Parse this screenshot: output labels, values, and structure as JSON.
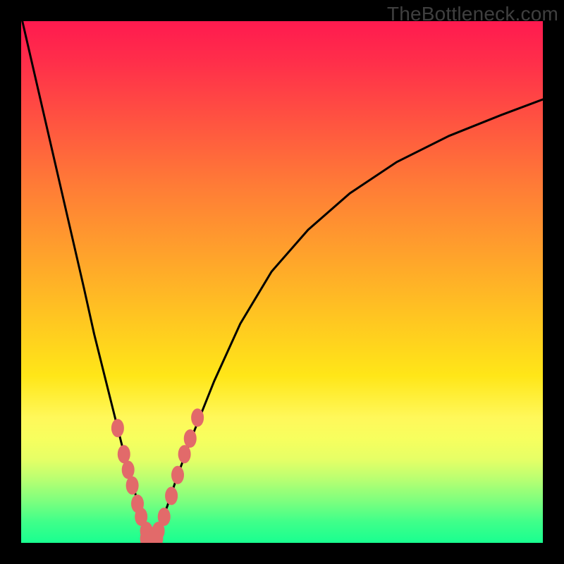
{
  "watermark": "TheBottleneck.com",
  "gradient": {
    "top": "#ff1a4f",
    "mid": "#ffe618",
    "bottom": "#19ff90"
  },
  "chart_data": {
    "type": "line",
    "title": "",
    "xlabel": "",
    "ylabel": "",
    "xlim": [
      0,
      100
    ],
    "ylim": [
      0,
      100
    ],
    "grid": false,
    "legend": false,
    "series": [
      {
        "name": "curve-left",
        "x": [
          0,
          3,
          6,
          9,
          12,
          14,
          16,
          18,
          20,
          22,
          23,
          24,
          25
        ],
        "y": [
          101,
          88,
          75,
          62,
          49,
          40,
          32,
          24,
          16,
          9,
          5,
          2,
          0
        ]
      },
      {
        "name": "curve-right",
        "x": [
          25,
          26,
          28,
          30,
          33,
          37,
          42,
          48,
          55,
          63,
          72,
          82,
          92,
          100
        ],
        "y": [
          0,
          2,
          7,
          13,
          21,
          31,
          42,
          52,
          60,
          67,
          73,
          78,
          82,
          85
        ]
      }
    ],
    "markers": [
      {
        "name": "cluster-left",
        "color": "#e26a6a",
        "points": [
          {
            "x": 18.5,
            "y": 22
          },
          {
            "x": 19.7,
            "y": 17
          },
          {
            "x": 20.5,
            "y": 14
          },
          {
            "x": 21.3,
            "y": 11
          },
          {
            "x": 22.3,
            "y": 7.5
          },
          {
            "x": 23.0,
            "y": 5
          },
          {
            "x": 24.0,
            "y": 2.3
          },
          {
            "x": 25.0,
            "y": 1.3
          }
        ]
      },
      {
        "name": "cluster-right",
        "color": "#e26a6a",
        "points": [
          {
            "x": 26.3,
            "y": 2.3
          },
          {
            "x": 27.4,
            "y": 5
          },
          {
            "x": 28.8,
            "y": 9
          },
          {
            "x": 30.0,
            "y": 13
          },
          {
            "x": 31.3,
            "y": 17
          },
          {
            "x": 32.4,
            "y": 20
          },
          {
            "x": 33.8,
            "y": 24
          }
        ]
      },
      {
        "name": "bottom-flat",
        "color": "#e26a6a",
        "points": [
          {
            "x": 24.0,
            "y": 0.8
          },
          {
            "x": 25.0,
            "y": 0.6
          },
          {
            "x": 26.0,
            "y": 0.8
          }
        ]
      }
    ]
  }
}
